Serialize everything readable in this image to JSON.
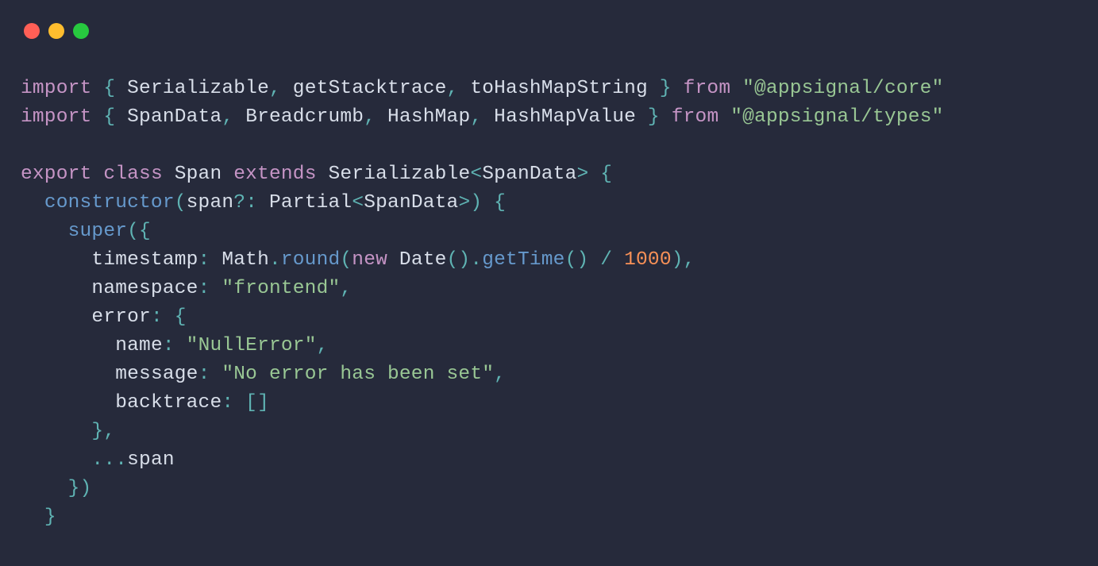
{
  "window": {
    "traffic_lights": [
      "close",
      "minimize",
      "zoom"
    ]
  },
  "code": {
    "line1": {
      "kw_import": "import",
      "brace_open": "{ ",
      "id1": "Serializable",
      "comma1": ", ",
      "id2": "getStacktrace",
      "comma2": ", ",
      "id3": "toHashMapString",
      "brace_close": " }",
      "kw_from": " from ",
      "str": "\"@appsignal/core\""
    },
    "line2": {
      "kw_import": "import",
      "brace_open": "{ ",
      "id1": "SpanData",
      "comma1": ", ",
      "id2": "Breadcrumb",
      "comma2": ", ",
      "id3": "HashMap",
      "comma3": ", ",
      "id4": "HashMapValue",
      "brace_close": " }",
      "kw_from": " from ",
      "str": "\"@appsignal/types\""
    },
    "line4": {
      "kw_export": "export",
      "kw_class": "class",
      "cls": "Span",
      "kw_extends": "extends",
      "base": "Serializable",
      "lt": "<",
      "targ": "SpanData",
      "gt": ">",
      "brace": " {"
    },
    "line5": {
      "ctor": "constructor",
      "open": "(",
      "param": "span",
      "opt": "?",
      "colon": ":",
      "ptype": " Partial",
      "lt": "<",
      "targ": "SpanData",
      "gt": ">",
      "close": ")",
      "brace": " {"
    },
    "line6": {
      "super": "super",
      "open": "({"
    },
    "line7": {
      "key": "timestamp",
      "colon": ":",
      "math": " Math",
      "dot1": ".",
      "round": "round",
      "open": "(",
      "newkw": "new",
      "date": " Date",
      "paren": "()",
      "dot2": ".",
      "gett": "getTime",
      "paren2": "()",
      "div": " / ",
      "num": "1000",
      "close": "),"
    },
    "line8": {
      "key": "namespace",
      "colon": ":",
      "str": " \"frontend\"",
      "comma": ","
    },
    "line9": {
      "key": "error",
      "colon": ":",
      "brace": " {"
    },
    "line10": {
      "key": "name",
      "colon": ":",
      "str": " \"NullError\"",
      "comma": ","
    },
    "line11": {
      "key": "message",
      "colon": ":",
      "str": " \"No error has been set\"",
      "comma": ","
    },
    "line12": {
      "key": "backtrace",
      "colon": ":",
      "arr": " []"
    },
    "line13": {
      "text": "},"
    },
    "line14": {
      "spread": "...",
      "id": "span"
    },
    "line15": {
      "text": "})"
    },
    "line16": {
      "text": "}"
    }
  }
}
